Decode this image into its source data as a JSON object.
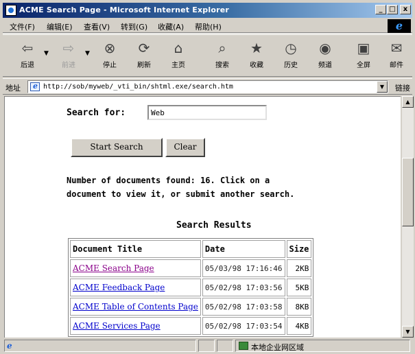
{
  "window": {
    "title": "ACME Search Page - Microsoft Internet Explorer",
    "controls": {
      "minimize": "_",
      "maximize": "□",
      "close": "x"
    }
  },
  "menu": {
    "items": [
      "文件(F)",
      "编辑(E)",
      "查看(V)",
      "转到(G)",
      "收藏(A)",
      "帮助(H)"
    ]
  },
  "toolbar": {
    "buttons": [
      {
        "label": "后退",
        "icon": "back-arrow-icon",
        "glyph": "⇦",
        "enabled": true
      },
      {
        "label": "前进",
        "icon": "forward-arrow-icon",
        "glyph": "⇨",
        "enabled": false
      },
      {
        "label": "停止",
        "icon": "stop-icon",
        "glyph": "⊗",
        "enabled": true
      },
      {
        "label": "刷新",
        "icon": "refresh-icon",
        "glyph": "⟳",
        "enabled": true
      },
      {
        "label": "主页",
        "icon": "home-icon",
        "glyph": "⌂",
        "enabled": true
      },
      {
        "label": "搜索",
        "icon": "search-icon",
        "glyph": "⌕",
        "enabled": true
      },
      {
        "label": "收藏",
        "icon": "favorites-icon",
        "glyph": "★",
        "enabled": true
      },
      {
        "label": "历史",
        "icon": "history-icon",
        "glyph": "◷",
        "enabled": true
      },
      {
        "label": "频道",
        "icon": "channels-icon",
        "glyph": "◉",
        "enabled": true
      },
      {
        "label": "全屏",
        "icon": "fullscreen-icon",
        "glyph": "▣",
        "enabled": true
      },
      {
        "label": "邮件",
        "icon": "mail-icon",
        "glyph": "✉",
        "enabled": true
      }
    ]
  },
  "address": {
    "label": "地址",
    "url": "http://sob/myweb/_vti_bin/shtml.exe/search.htm",
    "go_label": "链接"
  },
  "page": {
    "search_label": "Search for:",
    "search_value": "Web",
    "start_button": "Start Search",
    "clear_button": "Clear",
    "info_line1": "Number of documents found: 16. Click on a",
    "info_line2": "document to view it, or submit another search.",
    "results_heading": "Search Results",
    "table": {
      "headers": [
        "Document Title",
        "Date",
        "Size"
      ],
      "rows": [
        {
          "title": "ACME Search Page",
          "date": "05/03/98 17:16:46",
          "size": "2KB",
          "visited": true
        },
        {
          "title": "ACME Feedback Page",
          "date": "05/02/98 17:03:56",
          "size": "5KB",
          "visited": false
        },
        {
          "title": "ACME Table of Contents Page",
          "date": "05/02/98 17:03:58",
          "size": "8KB",
          "visited": false
        },
        {
          "title": "ACME Services Page",
          "date": "05/02/98 17:03:54",
          "size": "4KB",
          "visited": false
        }
      ]
    }
  },
  "status": {
    "zone_text": "本地企业网区域"
  }
}
